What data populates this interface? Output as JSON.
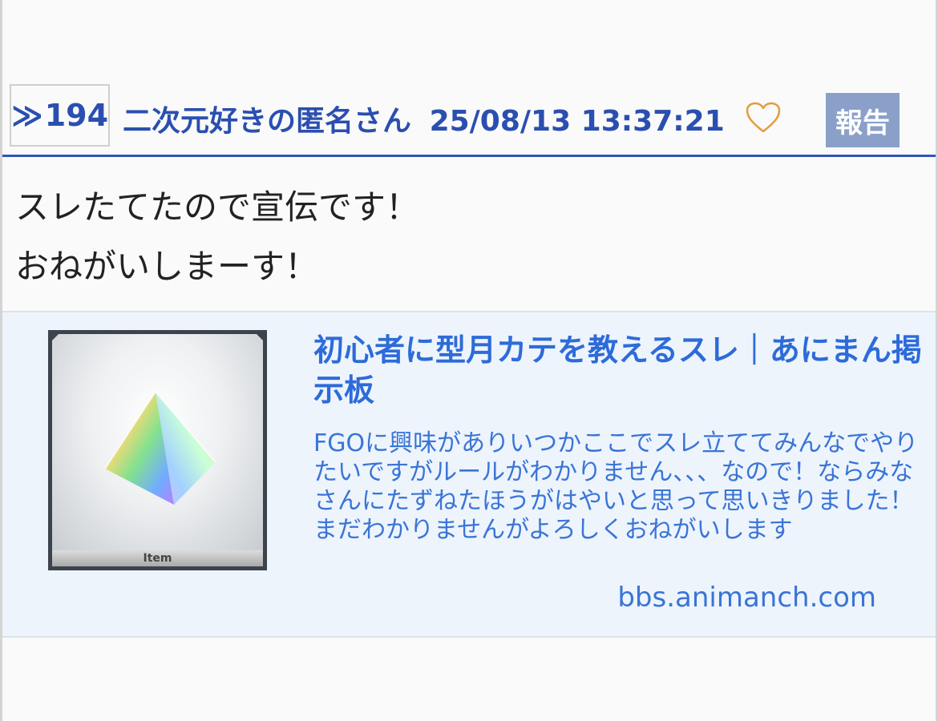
{
  "post": {
    "number_prefix": "≫",
    "number": "194",
    "author": "二次元好きの匿名さん",
    "datetime": "25/08/13 13:37:21",
    "like_icon": "heart-icon",
    "report_label": "報告",
    "body_lines": [
      "スレたてたので宣伝です！",
      "おねがいしまーす！"
    ]
  },
  "link_card": {
    "thumbnail_caption": "Item",
    "title": "初心者に型月カテを教えるスレ｜あにまん掲示板",
    "description": "FGOに興味がありいつかここでスレ立ててみんなでやりたいですがルールがわかりません、、、なので！ならみなさんにたずねたほうがはやいと思って思いきりました！まだわかりませんがよろしくおねがいします",
    "domain": "bbs.animanch.com"
  },
  "colors": {
    "accent_blue": "#2a4fb0",
    "link_blue": "#2d6bd9",
    "heart_orange": "#e89a3c",
    "report_bg": "#8aa0c9",
    "card_bg": "#edf4fc"
  }
}
